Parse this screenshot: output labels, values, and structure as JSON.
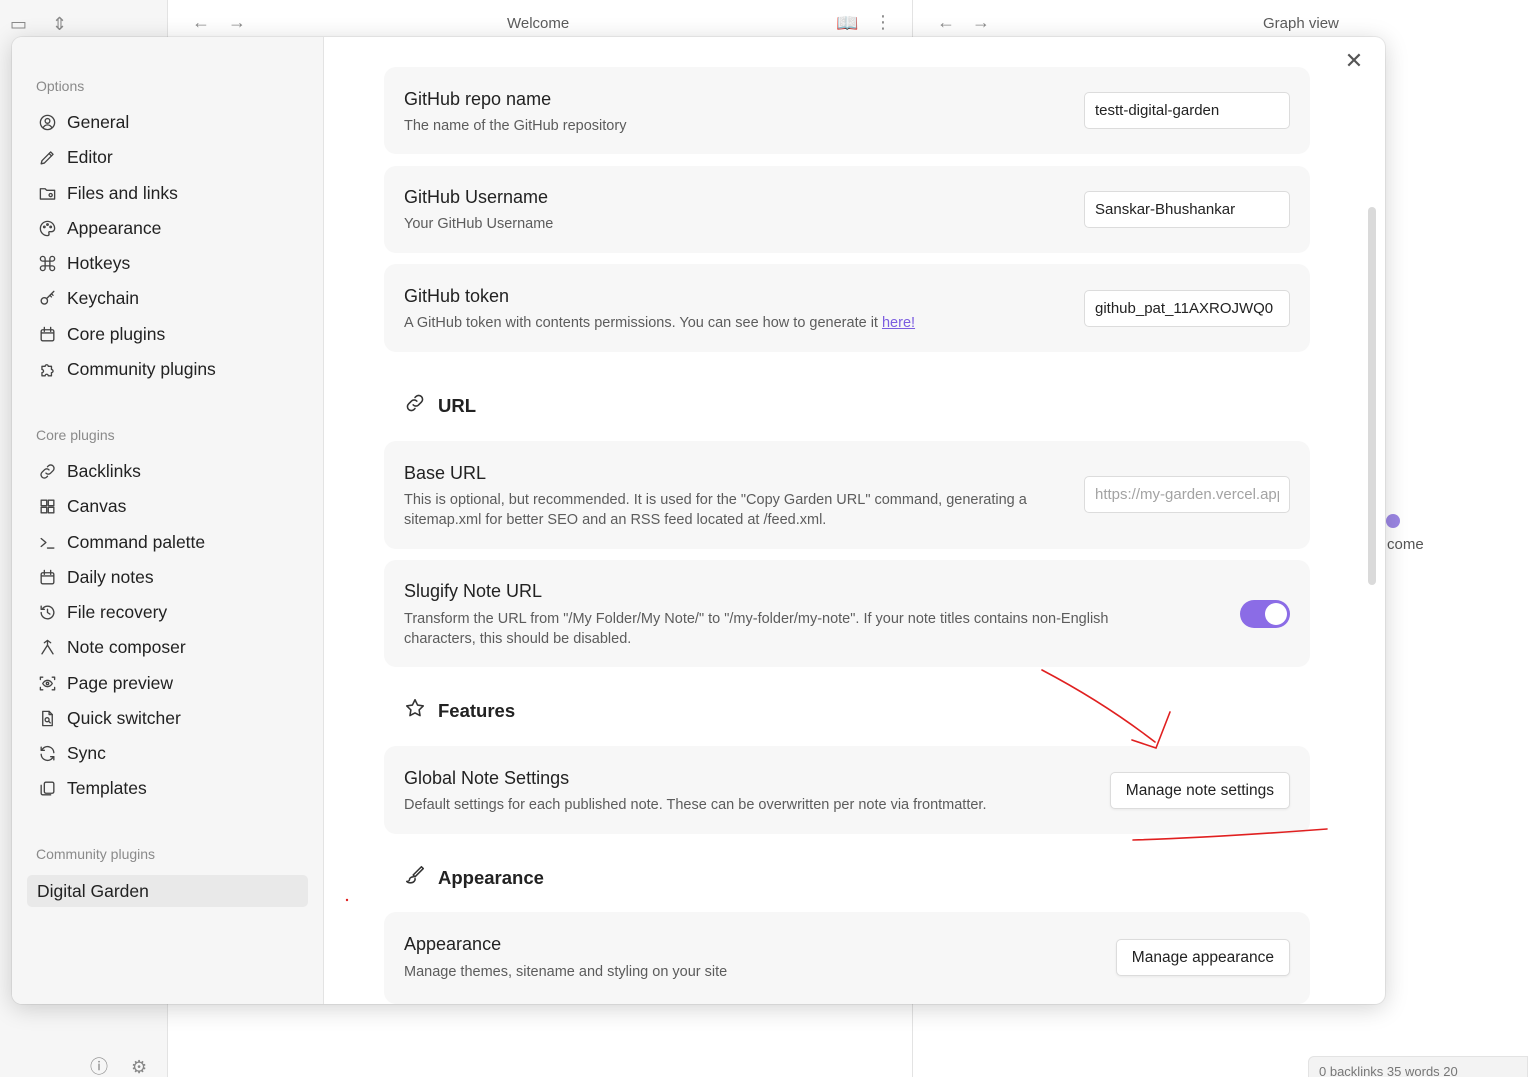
{
  "background": {
    "left_tab_title": "Welcome",
    "right_tab_title": "Graph view",
    "graph_node_label": "come",
    "status_bar": "0 backlinks   35 words  20"
  },
  "sidebar": {
    "options_heading": "Options",
    "options": [
      {
        "label": "General",
        "icon": "user-circle-icon"
      },
      {
        "label": "Editor",
        "icon": "pencil-icon"
      },
      {
        "label": "Files and links",
        "icon": "folder-icon"
      },
      {
        "label": "Appearance",
        "icon": "palette-icon"
      },
      {
        "label": "Hotkeys",
        "icon": "command-icon"
      },
      {
        "label": "Keychain",
        "icon": "key-icon"
      },
      {
        "label": "Core plugins",
        "icon": "calendar-icon"
      },
      {
        "label": "Community plugins",
        "icon": "puzzle-icon"
      }
    ],
    "core_heading": "Core plugins",
    "core": [
      {
        "label": "Backlinks",
        "icon": "link-icon"
      },
      {
        "label": "Canvas",
        "icon": "grid-icon"
      },
      {
        "label": "Command palette",
        "icon": "terminal-icon"
      },
      {
        "label": "Daily notes",
        "icon": "calendar-icon"
      },
      {
        "label": "File recovery",
        "icon": "history-icon"
      },
      {
        "label": "Note composer",
        "icon": "merge-icon"
      },
      {
        "label": "Page preview",
        "icon": "eye-icon"
      },
      {
        "label": "Quick switcher",
        "icon": "file-search-icon"
      },
      {
        "label": "Sync",
        "icon": "sync-icon"
      },
      {
        "label": "Templates",
        "icon": "copy-icon"
      }
    ],
    "community_heading": "Community plugins",
    "community": [
      {
        "label": "Digital Garden",
        "active": true
      }
    ]
  },
  "settings": {
    "repo_name": {
      "title": "GitHub repo name",
      "desc": "The name of the GitHub repository",
      "value": "testt-digital-garden"
    },
    "username": {
      "title": "GitHub Username",
      "desc": "Your GitHub Username",
      "value": "Sanskar-Bhushankar"
    },
    "token": {
      "title": "GitHub token",
      "desc": "A GitHub token with contents permissions. You can see how to generate it ",
      "link": "here!",
      "value": "github_pat_11AXROJWQ0"
    },
    "url_section": "URL",
    "base_url": {
      "title": "Base URL",
      "desc": "This is optional, but recommended. It is used for the \"Copy Garden URL\" command, generating a sitemap.xml for better SEO and an RSS feed located at /feed.xml.",
      "placeholder": "https://my-garden.vercel.app"
    },
    "slugify": {
      "title": "Slugify Note URL",
      "desc": "Transform the URL from \"/My Folder/My Note/\" to \"/my-folder/my-note\". If your note titles contains non-English characters, this should be disabled.",
      "enabled": true
    },
    "features_section": "Features",
    "global_note": {
      "title": "Global Note Settings",
      "desc": "Default settings for each published note. These can be overwritten per note via frontmatter.",
      "button": "Manage note settings"
    },
    "appearance_section": "Appearance",
    "appearance": {
      "title": "Appearance",
      "desc": "Manage themes, sitename and styling on your site",
      "button": "Manage appearance"
    }
  },
  "colors": {
    "accent": "#8b6ce6",
    "annotation": "#e02020"
  }
}
